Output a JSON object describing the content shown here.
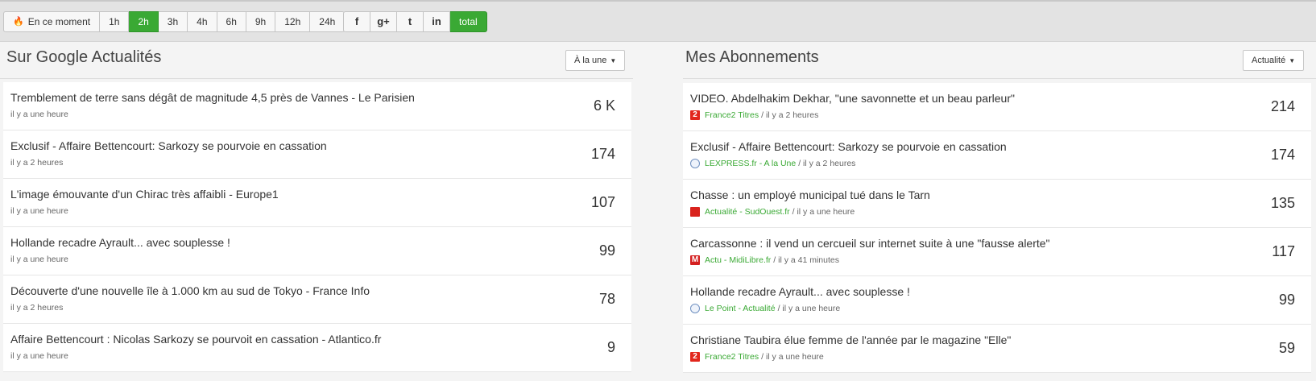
{
  "toolbar": {
    "time_buttons": [
      {
        "label": "En ce moment",
        "active": false
      },
      {
        "label": "1h",
        "active": false
      },
      {
        "label": "2h",
        "active": true
      },
      {
        "label": "3h",
        "active": false
      },
      {
        "label": "4h",
        "active": false
      },
      {
        "label": "6h",
        "active": false
      },
      {
        "label": "9h",
        "active": false
      },
      {
        "label": "12h",
        "active": false
      },
      {
        "label": "24h",
        "active": false
      }
    ],
    "social_buttons": [
      {
        "icon": "facebook-icon",
        "glyph": "f"
      },
      {
        "icon": "google-plus-icon",
        "glyph": "g+"
      },
      {
        "icon": "twitter-icon",
        "glyph": "t"
      },
      {
        "icon": "linkedin-icon",
        "glyph": "in"
      }
    ],
    "total_label": "total",
    "accent": "#3aa934"
  },
  "left": {
    "title": "Sur Google Actualités",
    "dropdown": "À la une",
    "items": [
      {
        "title": "Tremblement de terre sans dégât de magnitude 4,5 près de Vannes - Le Parisien",
        "time": "il y a une heure",
        "count": "6 K"
      },
      {
        "title": "Exclusif - Affaire Bettencourt: Sarkozy se pourvoie en cassation",
        "time": "il y a 2 heures",
        "count": "174"
      },
      {
        "title": "L'image émouvante d'un Chirac très affaibli - Europe1",
        "time": "il y a une heure",
        "count": "107"
      },
      {
        "title": "Hollande recadre Ayrault... avec souplesse !",
        "time": "il y a une heure",
        "count": "99"
      },
      {
        "title": "Découverte d'une nouvelle île à 1.000 km au sud de Tokyo - France Info",
        "time": "il y a 2 heures",
        "count": "78"
      },
      {
        "title": "Affaire Bettencourt : Nicolas Sarkozy se pourvoit en cassation - Atlantico.fr",
        "time": "il y a une heure",
        "count": "9"
      }
    ]
  },
  "right": {
    "title": "Mes Abonnements",
    "dropdown": "Actualité",
    "items": [
      {
        "title": "VIDEO. Abdelhakim Dekhar, \"une savonnette et un beau parleur\"",
        "source": "France2 Titres",
        "icon": "france2",
        "time": "/ il y a 2 heures",
        "count": "214"
      },
      {
        "title": "Exclusif - Affaire Bettencourt: Sarkozy se pourvoie en cassation",
        "source": "LEXPRESS.fr - A la Une",
        "icon": "globe",
        "time": "/ il y a 2 heures",
        "count": "174"
      },
      {
        "title": "Chasse : un employé municipal tué dans le Tarn",
        "source": "Actualité - SudOuest.fr",
        "icon": "sudouest",
        "time": "/ il y a une heure",
        "count": "135"
      },
      {
        "title": "Carcassonne : il vend un cercueil sur internet suite à une \"fausse alerte\"",
        "source": "Actu - MidiLibre.fr",
        "icon": "midilibre",
        "time": "/ il y a 41 minutes",
        "count": "117"
      },
      {
        "title": "Hollande recadre Ayrault... avec souplesse !",
        "source": "Le Point - Actualité",
        "icon": "globe",
        "time": "/ il y a une heure",
        "count": "99"
      },
      {
        "title": "Christiane Taubira élue femme de l'année par le magazine \"Elle\"",
        "source": "France2 Titres",
        "icon": "france2",
        "time": "/ il y a une heure",
        "count": "59"
      }
    ]
  }
}
